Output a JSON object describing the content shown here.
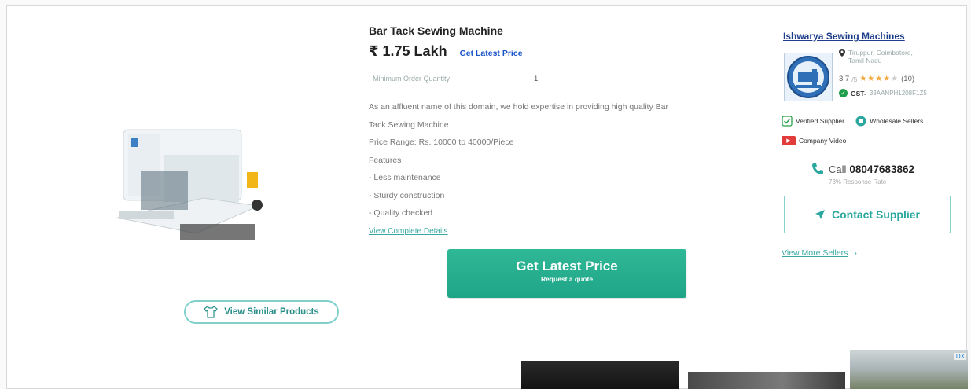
{
  "product": {
    "title": "Bar Tack Sewing Machine",
    "price": "₹ 1.75 Lakh",
    "get_latest_price_link": "Get Latest Price",
    "moq_label": "Minimum Order Quantity",
    "moq_value": "1",
    "description_lines": [
      "As an affluent name of this domain, we hold expertise in providing high quality Bar",
      "Tack Sewing Machine",
      "Price Range: Rs. 10000 to 40000/Piece",
      "Features",
      "- Less maintenance",
      "- Sturdy construction",
      "- Quality checked"
    ],
    "view_details_link": "View Complete Details",
    "cta_main": "Get Latest Price",
    "cta_sub": "Request a quote",
    "similar_button": "View Similar Products"
  },
  "supplier": {
    "name": "Ishwarya Sewing Machines",
    "location_line1": "Tiruppur, Coimbatore,",
    "location_line2": "Tamil Nadu",
    "rating_score": "3.7",
    "rating_outof": "/5",
    "rating_filled_stars": 4,
    "rating_count": "(10)",
    "gst_label": "GST-",
    "gst_number": "33AANPH1208F1Z5",
    "badge_verified": "Verified Supplier",
    "badge_wholesale": "Wholesale Sellers",
    "badge_video": "Company Video",
    "call_label": "Call",
    "call_number": "08047683862",
    "response_rate": "73% Response Rate",
    "contact_button": "Contact Supplier",
    "view_more_sellers": "View More Sellers",
    "view_more_chevron": "›"
  },
  "ads": {
    "badge": "DX"
  },
  "icons": {
    "location": "location-pin-icon",
    "check": "check-icon",
    "phone": "phone-icon",
    "send": "send-icon",
    "video": "video-icon"
  },
  "colors": {
    "accent": "#2fb896",
    "link": "#1a55c8",
    "teal_text": "#2aa89f",
    "star": "#f2a93b"
  }
}
